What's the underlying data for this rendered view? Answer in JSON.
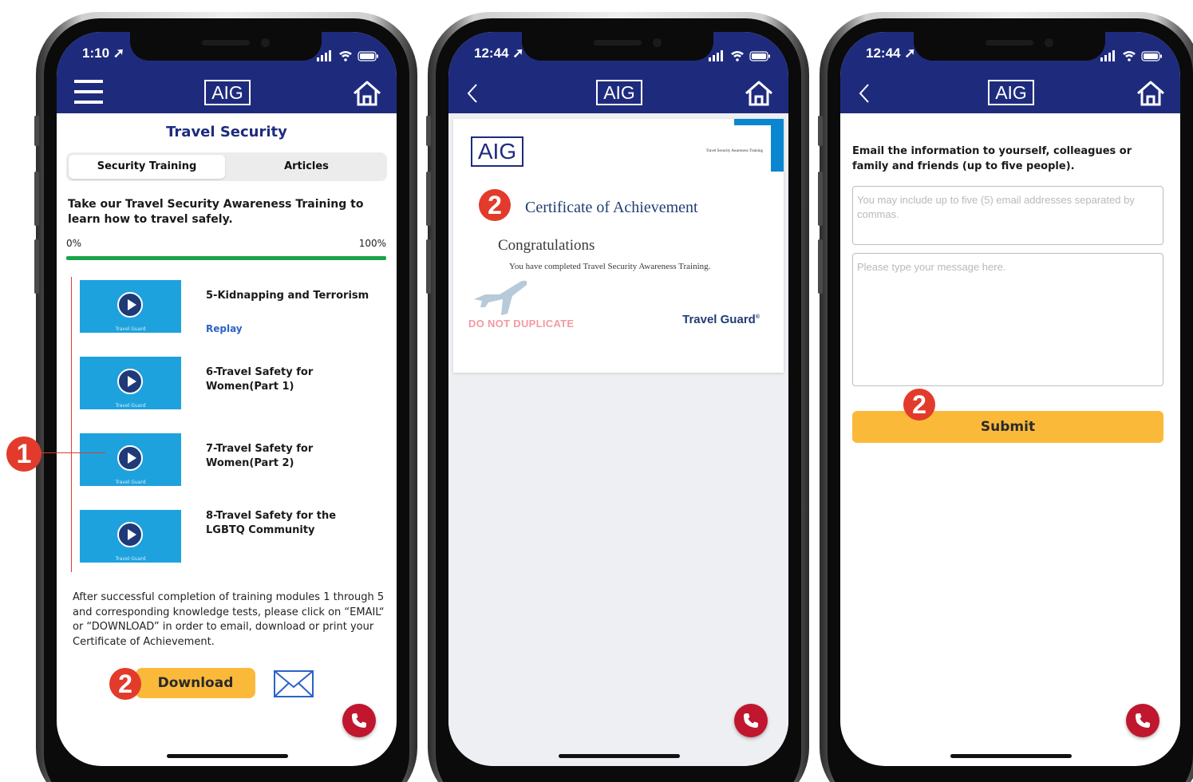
{
  "annotations": {
    "marker_one": "1",
    "marker_two": "2"
  },
  "common": {
    "brand": "AIG"
  },
  "screen1": {
    "time": "1:10",
    "title": "Travel Security",
    "tabs": [
      "Security Training",
      "Articles"
    ],
    "intro": "Take our Travel Security Awareness Training to learn how to travel safely.",
    "progress": {
      "start_label": "0%",
      "end_label": "100%",
      "fraction": 1.0
    },
    "modules": [
      {
        "title": "5-Kidnapping and Terrorism",
        "action": "Replay",
        "thumb_caption": "Travel Guard"
      },
      {
        "title": "6-Travel Safety for Women(Part 1)",
        "thumb_caption": "Travel Guard"
      },
      {
        "title": "7-Travel Safety for Women(Part 2)",
        "thumb_caption": "Travel Guard"
      },
      {
        "title": "8-Travel Safety for the LGBTQ Community",
        "thumb_caption": "Travel Guard"
      }
    ],
    "after_text": "After successful completion of training modules 1 through 5 and corresponding knowledge tests, please click on “EMAIL“ or “DOWNLOAD” in order to email, download or print your Certificate of Achievement.",
    "download_label": "Download"
  },
  "screen2": {
    "time": "12:44",
    "certificate": {
      "logo": "AIG",
      "small_label": "Travel Security Awareness Training",
      "title": "Certificate of Achievement",
      "congrats": "Congratulations",
      "completed": "You have completed Travel Security Awareness Training.",
      "stamp": "DO NOT DUPLICATE",
      "brand": "Travel Guard",
      "brand_mark": "®"
    }
  },
  "screen3": {
    "time": "12:44",
    "instructions": "Email the information to yourself, colleagues or family and friends (up to five people).",
    "emails_placeholder": "You may include up to five (5) email addresses separated by commas.",
    "message_placeholder": "Please type your message here.",
    "submit_label": "Submit"
  },
  "colors": {
    "header": "#1e2b7d",
    "accent_button": "#fbb93a",
    "progress": "#1aa34a",
    "marker": "#e23b2b",
    "call": "#c0172e"
  }
}
